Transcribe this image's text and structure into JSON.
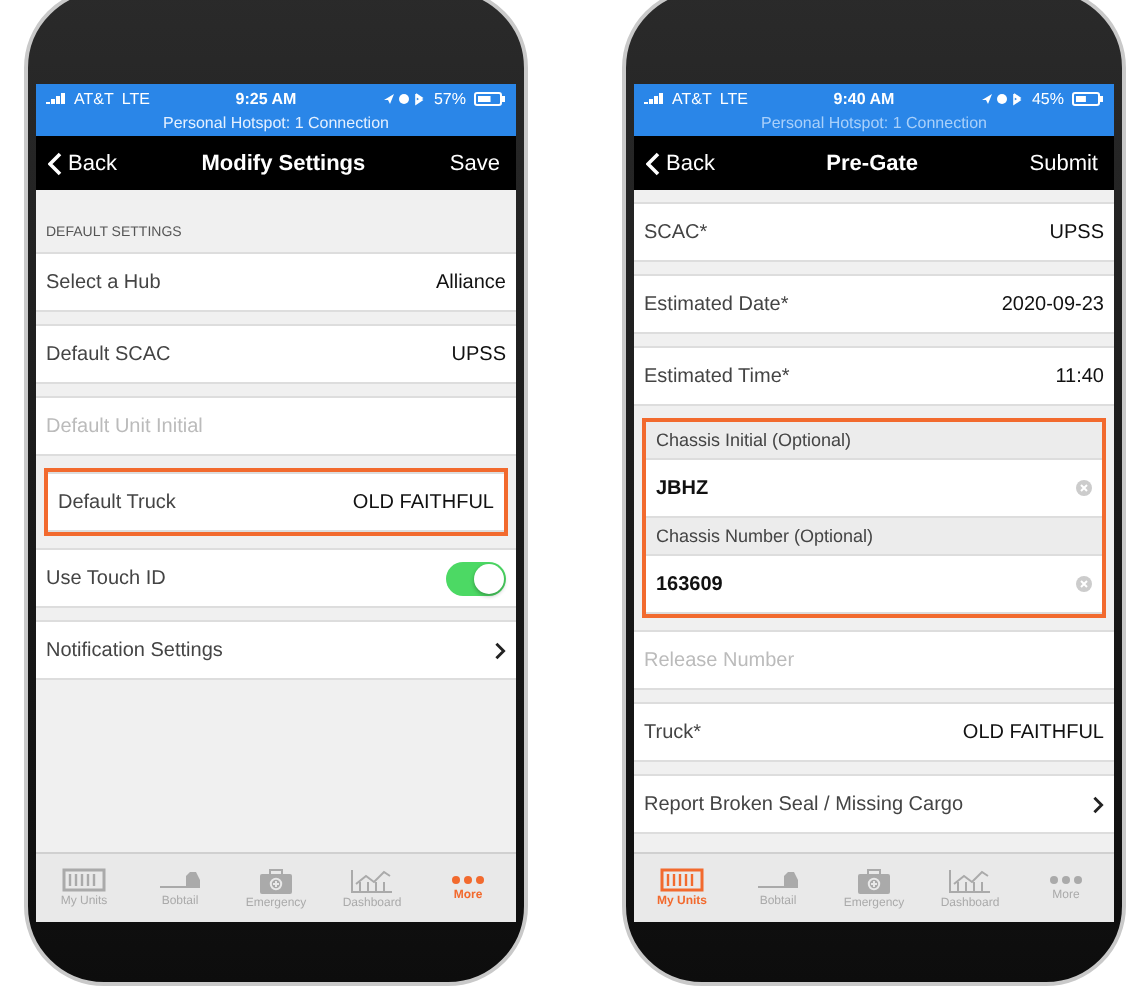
{
  "phones": [
    {
      "status": {
        "carrier": "AT&T",
        "network": "LTE",
        "time": "9:25 AM",
        "battery": "57%"
      },
      "hotspot": {
        "text": "Personal Hotspot: 1 Connection",
        "dimmed": false
      },
      "nav": {
        "back": "Back",
        "title": "Modify Settings",
        "action": "Save"
      },
      "section_header": "DEFAULT SETTINGS",
      "rows": [
        {
          "kind": "value",
          "label": "Select a Hub",
          "value": "Alliance",
          "highlighted": false
        },
        {
          "kind": "value",
          "label": "Default SCAC",
          "value": "UPSS",
          "highlighted": false
        },
        {
          "kind": "placeholder",
          "label": "Default Unit Initial",
          "highlighted": false
        },
        {
          "kind": "value",
          "label": "Default Truck",
          "value": "OLD FAITHFUL",
          "highlighted": true
        },
        {
          "kind": "toggle",
          "label": "Use Touch ID",
          "on": true,
          "highlighted": false
        },
        {
          "kind": "link",
          "label": "Notification Settings",
          "highlighted": false
        }
      ],
      "tabs": [
        {
          "label": "My Units",
          "selected": false
        },
        {
          "label": "Bobtail",
          "selected": false
        },
        {
          "label": "Emergency",
          "selected": false
        },
        {
          "label": "Dashboard",
          "selected": false
        },
        {
          "label": "More",
          "selected": true
        }
      ]
    },
    {
      "status": {
        "carrier": "AT&T",
        "network": "LTE",
        "time": "9:40 AM",
        "battery": "45%"
      },
      "hotspot": {
        "text": "Personal Hotspot: 1 Connection",
        "dimmed": true
      },
      "nav": {
        "back": "Back",
        "title": "Pre-Gate",
        "action": "Submit"
      },
      "rows": [
        {
          "kind": "value",
          "label": "SCAC*",
          "value": "UPSS",
          "highlighted": false
        },
        {
          "kind": "value",
          "label": "Estimated Date*",
          "value": "2020-09-23",
          "highlighted": false
        },
        {
          "kind": "value",
          "label": "Estimated Time*",
          "value": "11:40",
          "highlighted": false
        },
        {
          "kind": "field_label",
          "label": "Chassis Initial (Optional)",
          "highlighted": true
        },
        {
          "kind": "input",
          "value": "JBHZ",
          "highlighted": true
        },
        {
          "kind": "field_label",
          "label": "Chassis Number (Optional)",
          "highlighted": true
        },
        {
          "kind": "input",
          "value": "163609",
          "highlighted": true
        },
        {
          "kind": "placeholder",
          "label": "Release Number",
          "highlighted": false
        },
        {
          "kind": "value",
          "label": "Truck*",
          "value": "OLD FAITHFUL",
          "highlighted": false
        },
        {
          "kind": "link",
          "label": "Report Broken Seal / Missing Cargo",
          "highlighted": false
        }
      ],
      "tabs": [
        {
          "label": "My Units",
          "selected": true
        },
        {
          "label": "Bobtail",
          "selected": false
        },
        {
          "label": "Emergency",
          "selected": false
        },
        {
          "label": "Dashboard",
          "selected": false
        },
        {
          "label": "More",
          "selected": false
        }
      ]
    }
  ]
}
